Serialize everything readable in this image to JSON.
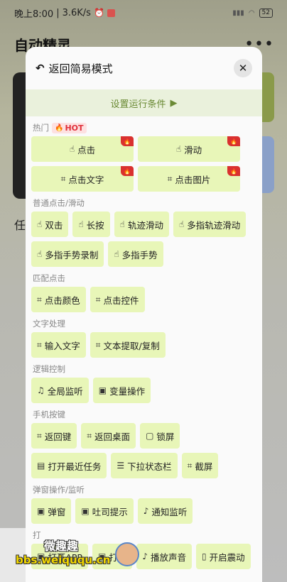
{
  "status_bar": {
    "time": "晚上8:00",
    "speed": "3.6K/s",
    "battery": "52"
  },
  "background": {
    "title": "自动精灵",
    "more": "•••",
    "partial_text": "任"
  },
  "modal": {
    "back_label": "返回简易模式",
    "close_symbol": "✕",
    "set_condition": "设置运行条件",
    "sections": [
      {
        "title": "热门",
        "hot_badge": "HOT",
        "buttons": [
          {
            "label": "点击",
            "icon": "tap-hand-icon",
            "hot": true
          },
          {
            "label": "滑动",
            "icon": "swipe-hand-icon",
            "hot": true
          },
          {
            "label": "点击文字",
            "icon": "scan-text-icon",
            "hot": true
          },
          {
            "label": "点击图片",
            "icon": "scan-image-icon",
            "hot": true
          }
        ]
      },
      {
        "title": "普通点击/滑动",
        "buttons": [
          {
            "label": "双击",
            "icon": "double-tap-icon"
          },
          {
            "label": "长按",
            "icon": "long-press-icon"
          },
          {
            "label": "轨迹滑动",
            "icon": "track-swipe-icon"
          },
          {
            "label": "多指轨迹滑动",
            "icon": "multi-finger-track-icon"
          },
          {
            "label": "多指手势录制",
            "icon": "multi-finger-record-icon"
          },
          {
            "label": "多指手势",
            "icon": "multi-finger-gesture-icon"
          }
        ]
      },
      {
        "title": "匹配点击",
        "buttons": [
          {
            "label": "点击颜色",
            "icon": "color-target-icon"
          },
          {
            "label": "点击控件",
            "icon": "widget-target-icon"
          }
        ]
      },
      {
        "title": "文字处理",
        "buttons": [
          {
            "label": "输入文字",
            "icon": "input-text-icon"
          },
          {
            "label": "文本提取/复制",
            "icon": "extract-text-icon"
          }
        ]
      },
      {
        "title": "逻辑控制",
        "buttons": [
          {
            "label": "全局监听",
            "icon": "headphones-icon"
          },
          {
            "label": "变量操作",
            "icon": "variable-icon"
          }
        ]
      },
      {
        "title": "手机按键",
        "buttons": [
          {
            "label": "返回键",
            "icon": "back-key-icon"
          },
          {
            "label": "返回桌面",
            "icon": "home-key-icon"
          },
          {
            "label": "锁屏",
            "icon": "lock-screen-icon"
          },
          {
            "label": "打开最近任务",
            "icon": "recent-tasks-icon"
          },
          {
            "label": "下拉状态栏",
            "icon": "pull-down-icon"
          },
          {
            "label": "截屏",
            "icon": "screenshot-icon"
          }
        ]
      },
      {
        "title": "弹窗操作/监听",
        "buttons": [
          {
            "label": "弹窗",
            "icon": "popup-icon"
          },
          {
            "label": "吐司提示",
            "icon": "toast-icon"
          },
          {
            "label": "通知监听",
            "icon": "bell-icon"
          }
        ]
      },
      {
        "title": "打",
        "buttons": [
          {
            "label": "打开APP",
            "icon": "open-app-icon"
          },
          {
            "label": "打开",
            "icon": "open-icon"
          },
          {
            "label": "播放声音",
            "icon": "speaker-icon"
          },
          {
            "label": "开启震动",
            "icon": "vibrate-icon"
          }
        ]
      }
    ]
  },
  "watermark": {
    "line1": "微趣趣",
    "line2": "bbs.weiququ.cn"
  }
}
